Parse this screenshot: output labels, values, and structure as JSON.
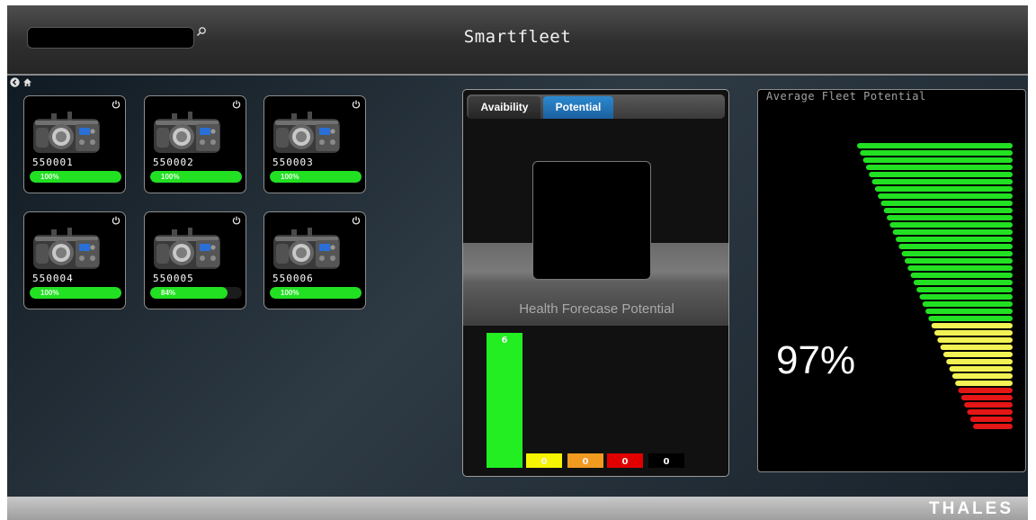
{
  "header": {
    "title": "Smartfleet",
    "search": {
      "value": ""
    }
  },
  "radios": [
    {
      "id": "550001",
      "potential_label": "100%",
      "potential": 100
    },
    {
      "id": "550002",
      "potential_label": "100%",
      "potential": 100
    },
    {
      "id": "550003",
      "potential_label": "100%",
      "potential": 100
    },
    {
      "id": "550004",
      "potential_label": "100%",
      "potential": 100
    },
    {
      "id": "550005",
      "potential_label": "84%",
      "potential": 84
    },
    {
      "id": "550006",
      "potential_label": "100%",
      "potential": 100
    }
  ],
  "potential_panel": {
    "tabs": [
      {
        "label": "Avaibility",
        "active": false
      },
      {
        "label": "Potential",
        "active": true
      }
    ],
    "forecast_title": "Health Forecase Potential"
  },
  "chart_data": {
    "type": "bar",
    "categories": [
      "green",
      "yellow",
      "orange",
      "red",
      "black"
    ],
    "values": [
      6,
      0,
      0,
      0,
      0
    ],
    "colors": [
      "#22ee22",
      "#f5f500",
      "#f09a20",
      "#e00000",
      "#000000"
    ],
    "title": "",
    "xlabel": "",
    "ylabel": ""
  },
  "average_fleet": {
    "title": "Average Fleet Potential",
    "value_label": "97%",
    "value": 97
  },
  "footer": {
    "brand": "THALES"
  },
  "colors": {
    "ok_green": "#22e022",
    "warn_yellow": "#f2f254",
    "alert_red": "#e41616",
    "tab_active": "#1f6fb5"
  },
  "icons": [
    "search-icon",
    "back-icon",
    "home-icon",
    "power-icon"
  ]
}
